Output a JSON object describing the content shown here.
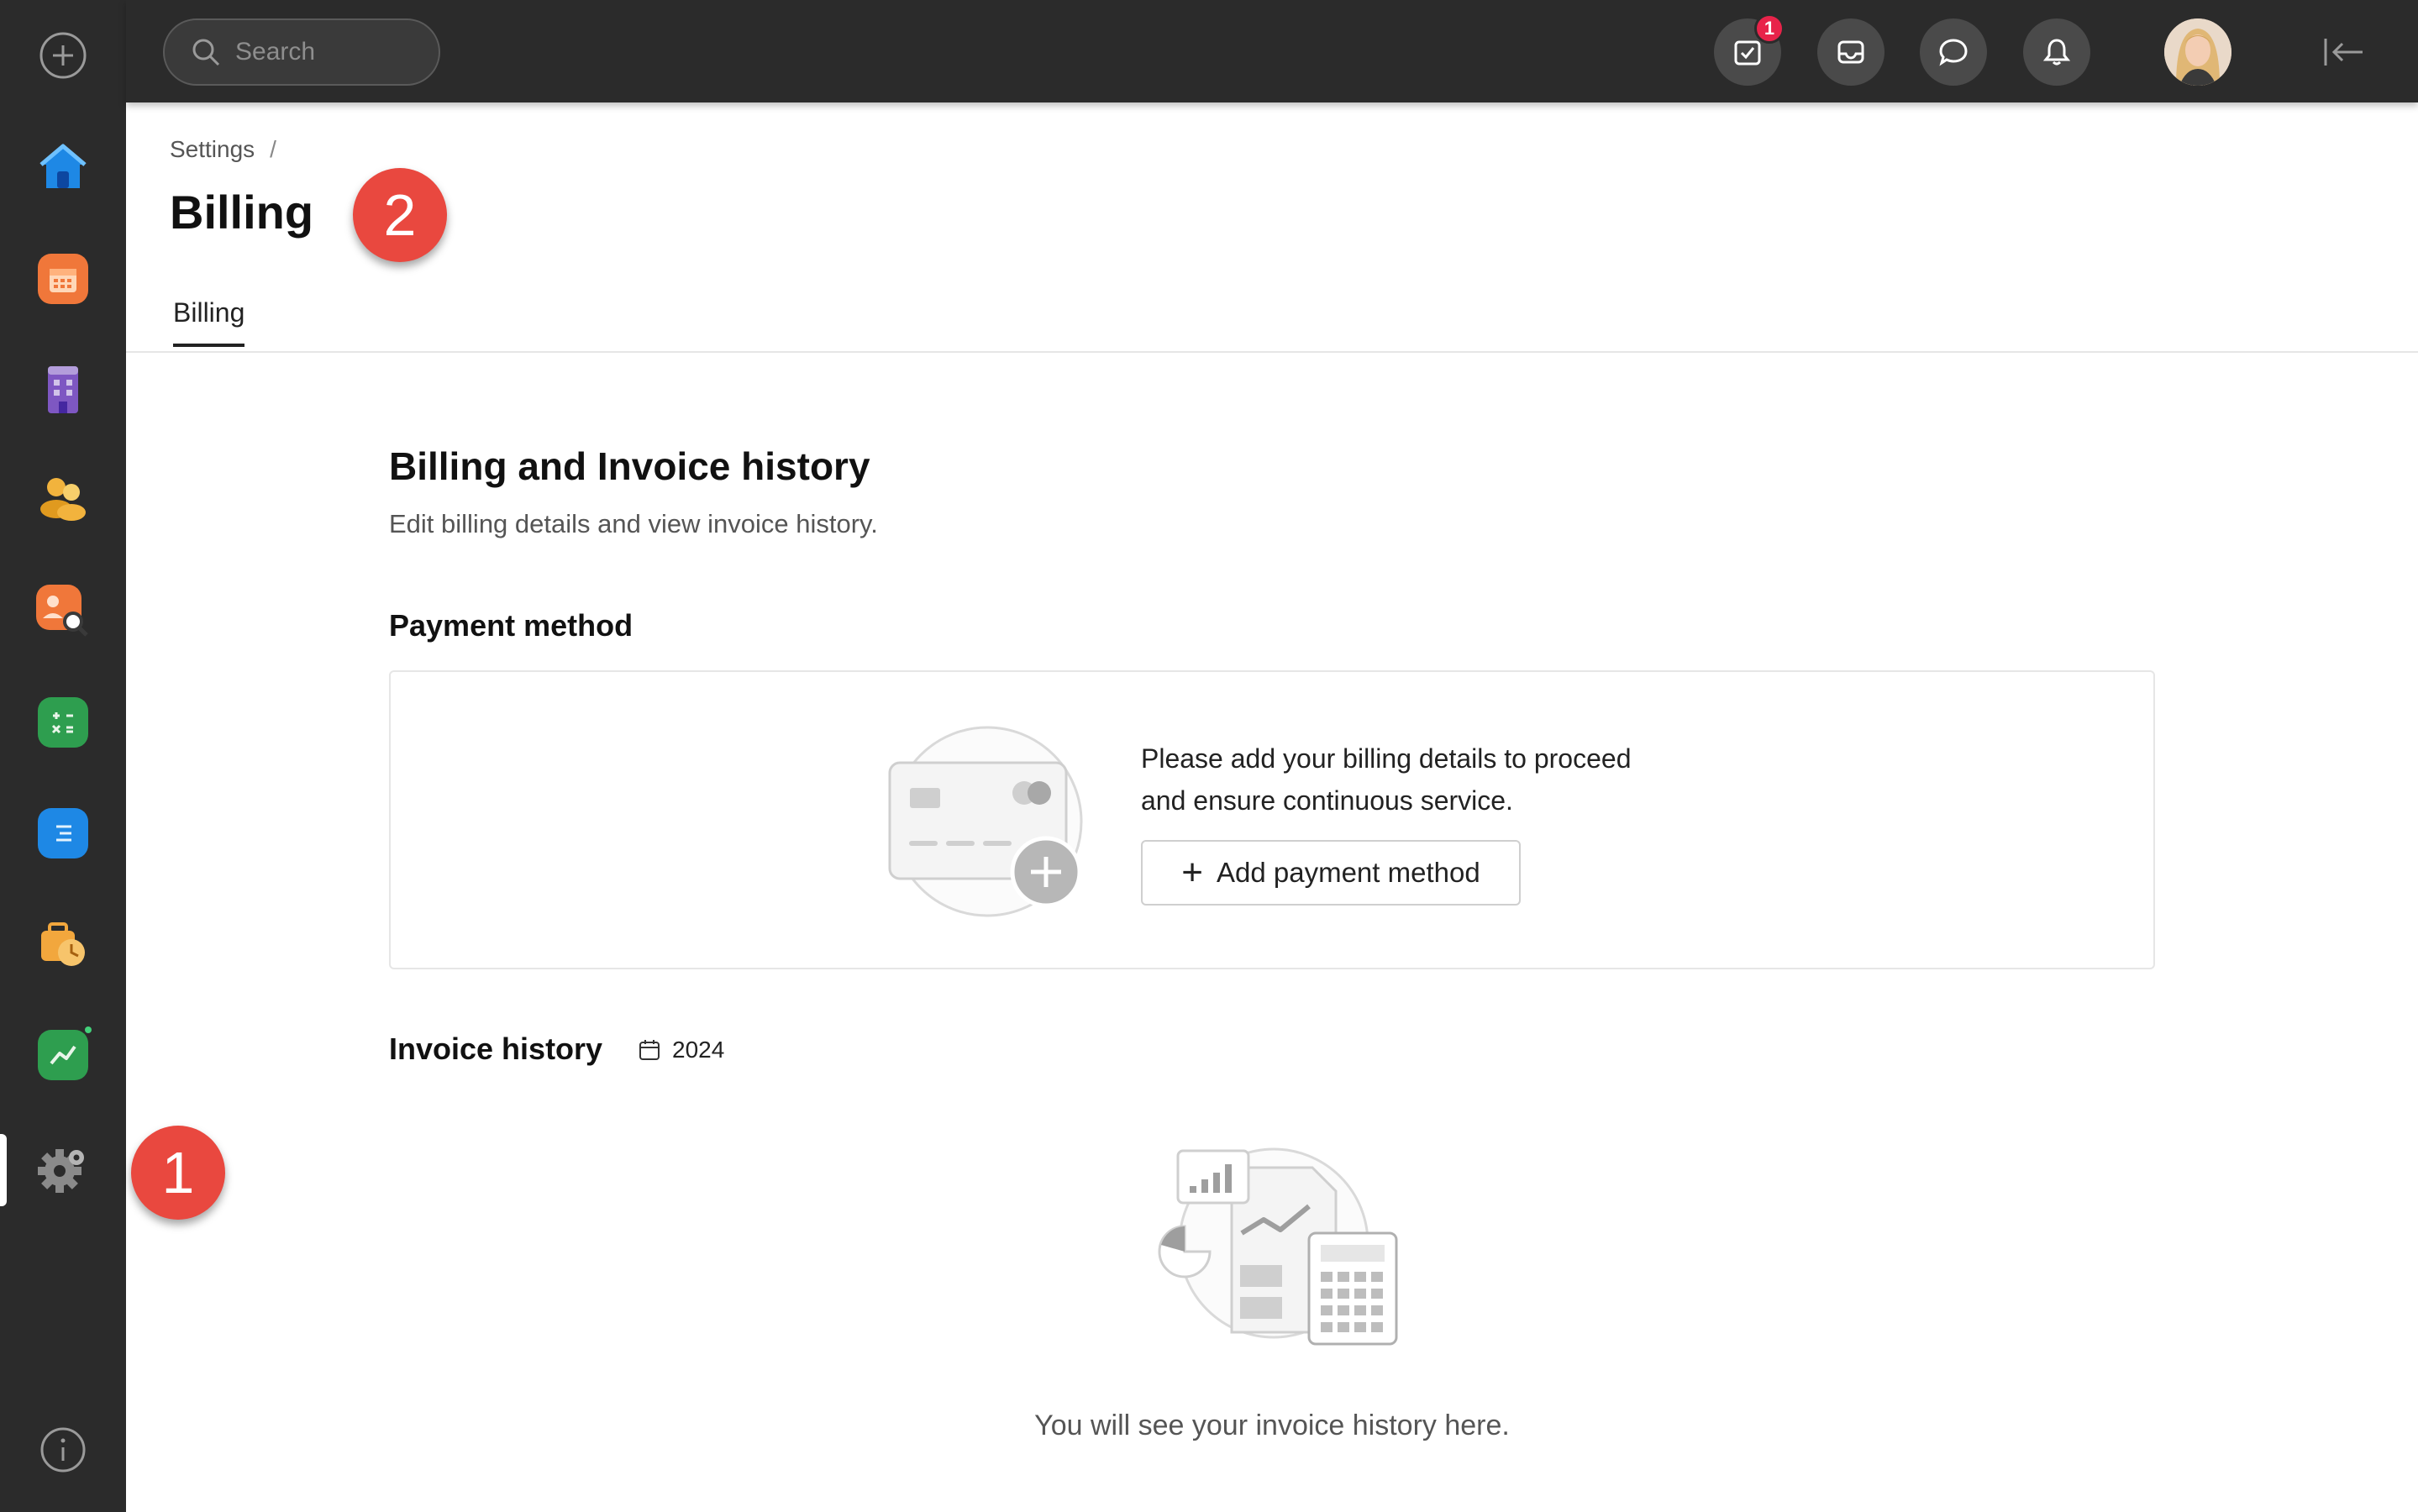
{
  "sidebar": {
    "add_icon": "plus-circle-icon",
    "apps": [
      {
        "name": "home",
        "color": "#1e88e5"
      },
      {
        "name": "calendar",
        "color": "#f0773a"
      },
      {
        "name": "building",
        "color": "#7e57c2"
      },
      {
        "name": "people",
        "color": "#f2b33d"
      },
      {
        "name": "user-search",
        "color": "#f0773a"
      },
      {
        "name": "spreadsheet",
        "color": "#2e9e4f"
      },
      {
        "name": "document",
        "color": "#1e88e5"
      },
      {
        "name": "briefcase-clock",
        "color": "#f2a73d"
      },
      {
        "name": "chart",
        "color": "#2e9e4f"
      },
      {
        "name": "settings",
        "color": "#8a8a8a"
      }
    ],
    "info_icon": "info-icon"
  },
  "topbar": {
    "search_placeholder": "Search",
    "tasks_badge": "1"
  },
  "breadcrumb": {
    "parent": "Settings",
    "separator": "/"
  },
  "page": {
    "title": "Billing",
    "tab": "Billing"
  },
  "annotations": {
    "one": "1",
    "two": "2"
  },
  "billing": {
    "title": "Billing and Invoice history",
    "description": "Edit billing details and view invoice history.",
    "payment_title": "Payment method",
    "payment_prompt_line1": "Please add your billing details to proceed",
    "payment_prompt_line2": "and ensure continuous service.",
    "add_payment_label": "Add payment method",
    "invoice_title": "Invoice history",
    "invoice_year": "2024",
    "invoice_empty": "You will see your invoice history here."
  }
}
